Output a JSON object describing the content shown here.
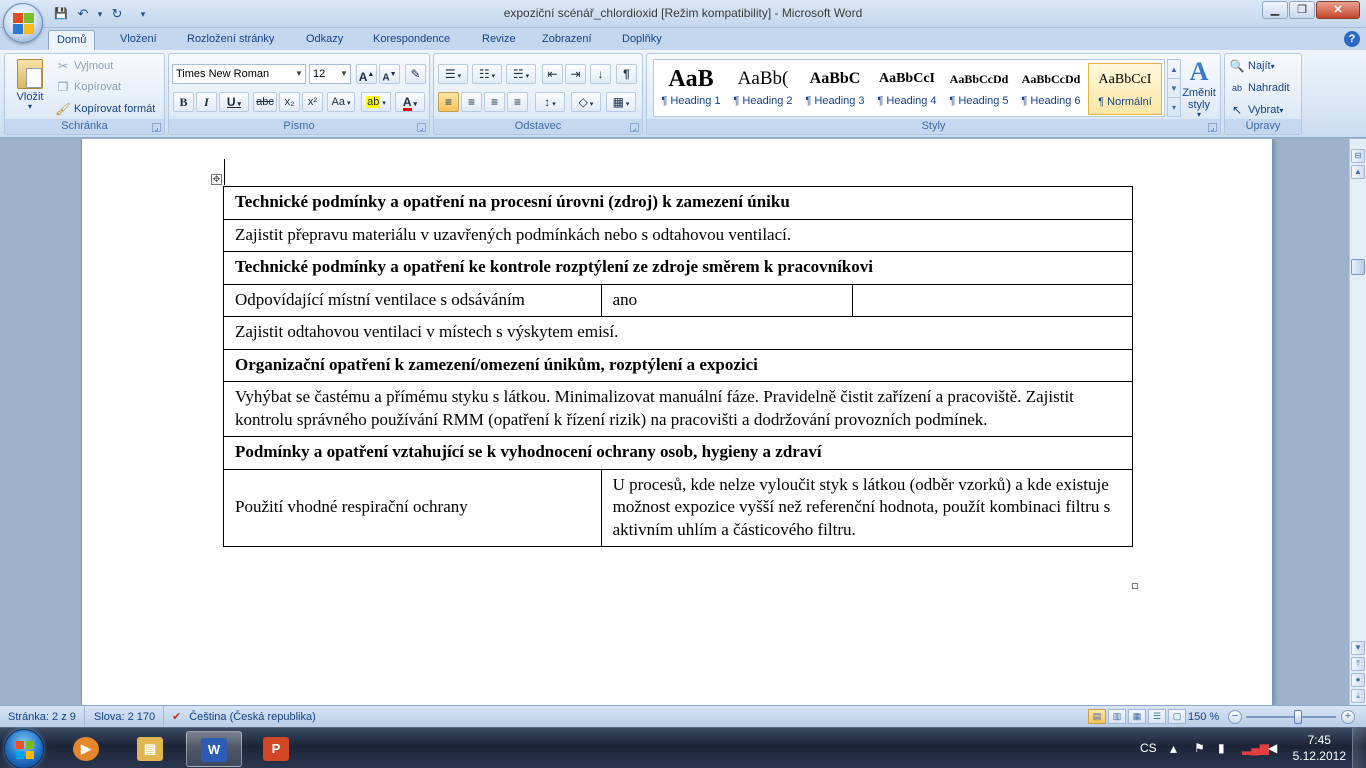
{
  "window": {
    "title": "expoziční scénář_chlordioxid [Režim kompatibility] - Microsoft Word",
    "controls": {
      "minimize": "▁",
      "restore": "❐",
      "close": "✕"
    }
  },
  "qat": {
    "save": "💾",
    "undo": "↶",
    "undo_dd": "▾",
    "redo": "↻",
    "customize": "▾"
  },
  "tabs": [
    {
      "label": "Domů"
    },
    {
      "label": "Vložení"
    },
    {
      "label": "Rozložení stránky"
    },
    {
      "label": "Odkazy"
    },
    {
      "label": "Korespondence"
    },
    {
      "label": "Revize"
    },
    {
      "label": "Zobrazení"
    },
    {
      "label": "Doplňky"
    }
  ],
  "help": "?",
  "ribbon": {
    "clipboard": {
      "label": "Schránka",
      "paste": "Vložit",
      "paste_dd": "▾",
      "cut": "Vyjmout",
      "copy": "Kopírovat",
      "format_painter": "Kopírovat formát"
    },
    "font": {
      "label": "Písmo",
      "font_name": "Times New Roman",
      "font_size": "12",
      "grow": "A",
      "shrink": "A",
      "clear": "✎",
      "bold": "B",
      "italic": "I",
      "underline": "U",
      "strike": "abc",
      "subscript": "x₂",
      "superscript": "x²",
      "change_case": "Aa",
      "highlight": "ab",
      "font_color": "A",
      "highlight_color": "#ffff00",
      "font_color_value": "#ff0000"
    },
    "paragraph": {
      "label": "Odstavec",
      "bullets": "☰",
      "numbering": "☷",
      "multilevel": "☵",
      "decrease_indent": "⇤",
      "increase_indent": "⇥",
      "sort": "↓",
      "show_marks": "¶",
      "align_left": "≡",
      "align_center": "≡",
      "align_right": "≡",
      "justify": "≡",
      "line_spacing": "↕",
      "shading": "◇",
      "borders": "▦"
    },
    "styles": {
      "label": "Styly",
      "items": [
        {
          "sample": "AaB",
          "name": "¶ Heading 1"
        },
        {
          "sample": "AaBb(",
          "name": "¶ Heading 2"
        },
        {
          "sample": "AaBbC",
          "name": "¶ Heading 3"
        },
        {
          "sample": "AaBbCcI",
          "name": "¶ Heading 4"
        },
        {
          "sample": "AaBbCcDd",
          "name": "¶ Heading 5"
        },
        {
          "sample": "AaBbCcDd",
          "name": "¶ Heading 6"
        },
        {
          "sample": "AaBbCcI",
          "name": "¶ Normální"
        }
      ],
      "change_styles": "Změnit styly",
      "change_styles_dd": "▾",
      "scroll_up": "▲",
      "scroll_down": "▼",
      "more": "▾"
    },
    "editing": {
      "label": "Úpravy",
      "find": "Najít",
      "find_dd": "▾",
      "replace": "Nahradit",
      "select": "Vybrat",
      "select_dd": "▾"
    }
  },
  "document": {
    "move_handle": "✥",
    "rows": [
      {
        "type": "header",
        "text": "Technické podmínky  a opatření  na procesní  úrovni  (zdroj) k zamezení úniku"
      },
      {
        "type": "full",
        "text": "Zajistit přepravu materiálu v uzavřených podmínkách nebo s odtahovou ventilací."
      },
      {
        "type": "header",
        "text": "Technické podmínky  a opatření  ke kontrole rozptýlení  ze zdroje směrem k pracovníkovi"
      },
      {
        "type": "three",
        "cells": [
          "Odpovídající místní ventilace s odsáváním",
          "ano",
          ""
        ]
      },
      {
        "type": "full",
        "text": "Zajistit odtahovou ventilaci v místech s výskytem emisí."
      },
      {
        "type": "header",
        "text": "Organizační  opatření k zamezení/omezení únikům,  rozptýlení  a expozici"
      },
      {
        "type": "full",
        "text": "Vyhýbat se častému a přímému styku s látkou. Minimalizovat manuální fáze. Pravidelně čistit zařízení a pracoviště. Zajistit kontrolu správného používání RMM (opatření k řízení rizik) na pracovišti a dodržování provozních podmínek."
      },
      {
        "type": "header",
        "text": "Podmínky  a opatření  vztahující se k vyhodnocení  ochrany  osob, hygieny  a zdraví"
      },
      {
        "type": "two",
        "cells": [
          "Použití vhodné respirační ochrany",
          "U procesů, kde nelze vyloučit styk s látkou (odběr vzorků) a kde existuje možnost expozice vyšší než referenční hodnota, použít kombinaci filtru s aktivním uhlím a částicového filtru."
        ]
      }
    ]
  },
  "scrollbar": {
    "up": "▲",
    "down": "▼",
    "prev_page": "⤒",
    "browse": "●",
    "next_page": "⤓",
    "ruler": "⊟"
  },
  "status": {
    "page": "Stránka: 2 z 9",
    "words": "Slova: 2 170",
    "language": "Čeština (Česká republika)",
    "proof_icon": "✔",
    "zoom": "150 %",
    "zoom_minus": "−",
    "zoom_plus": "+",
    "views": [
      "▤",
      "▥",
      "▦",
      "☰",
      "▢"
    ]
  },
  "taskbar": {
    "apps": [
      {
        "name": "Media Player",
        "glyph": "▶",
        "color": "#e5862a"
      },
      {
        "name": "Explorer",
        "glyph": "▤",
        "color": "#e2b650"
      },
      {
        "name": "Word",
        "glyph": "W",
        "color": "#2b5db4"
      },
      {
        "name": "PowerPoint",
        "glyph": "P",
        "color": "#d24726"
      }
    ],
    "lang": "CS",
    "time": "7:45",
    "date": "5.12.2012"
  }
}
